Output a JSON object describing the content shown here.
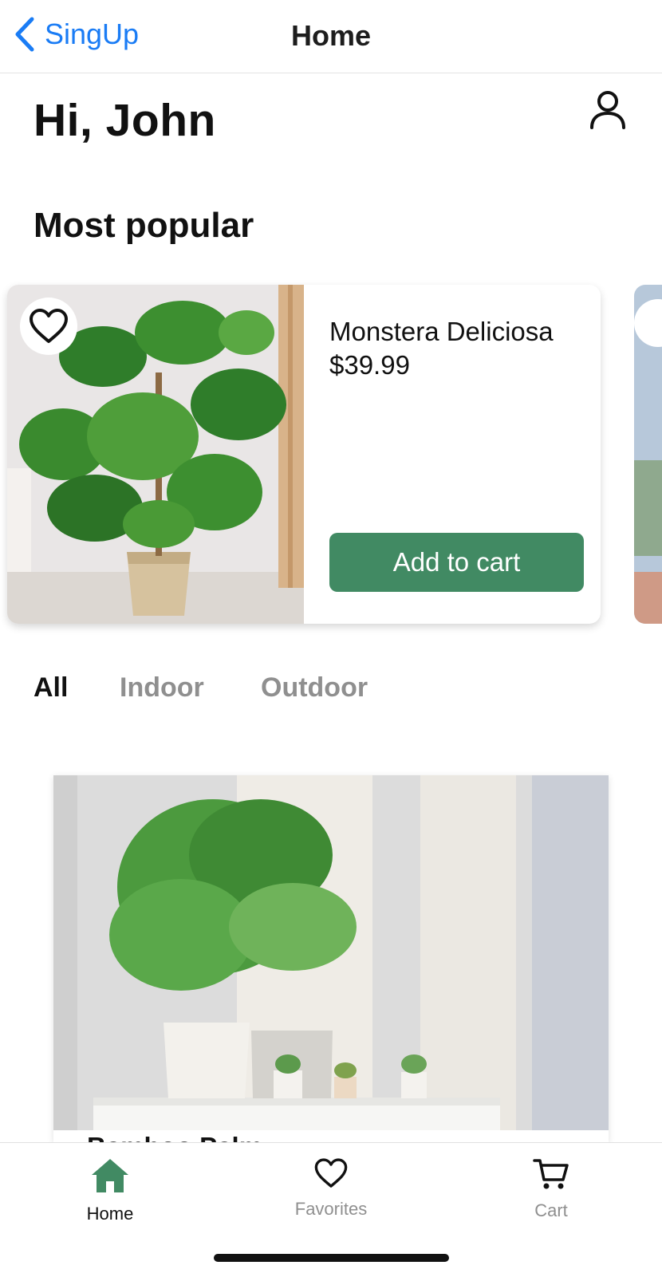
{
  "navbar": {
    "back_label": "SingUp",
    "title": "Home"
  },
  "greeting": "Hi, John",
  "popular": {
    "section_title": "Most popular",
    "items": [
      {
        "name": "Monstera Deliciosa",
        "price": "$39.99",
        "button_label": "Add to cart"
      }
    ]
  },
  "filters": {
    "tabs": [
      "All",
      "Indoor",
      "Outdoor"
    ],
    "active": "All"
  },
  "products": [
    {
      "name": "Bamboo Palm"
    }
  ],
  "tabbar": {
    "items": [
      {
        "label": "Home",
        "icon": "home-icon",
        "active": true
      },
      {
        "label": "Favorites",
        "icon": "heart-icon",
        "active": false
      },
      {
        "label": "Cart",
        "icon": "cart-icon",
        "active": false
      }
    ]
  },
  "colors": {
    "accent": "#418a63",
    "link": "#1a7cf5",
    "inactive": "#8f8f8f"
  }
}
